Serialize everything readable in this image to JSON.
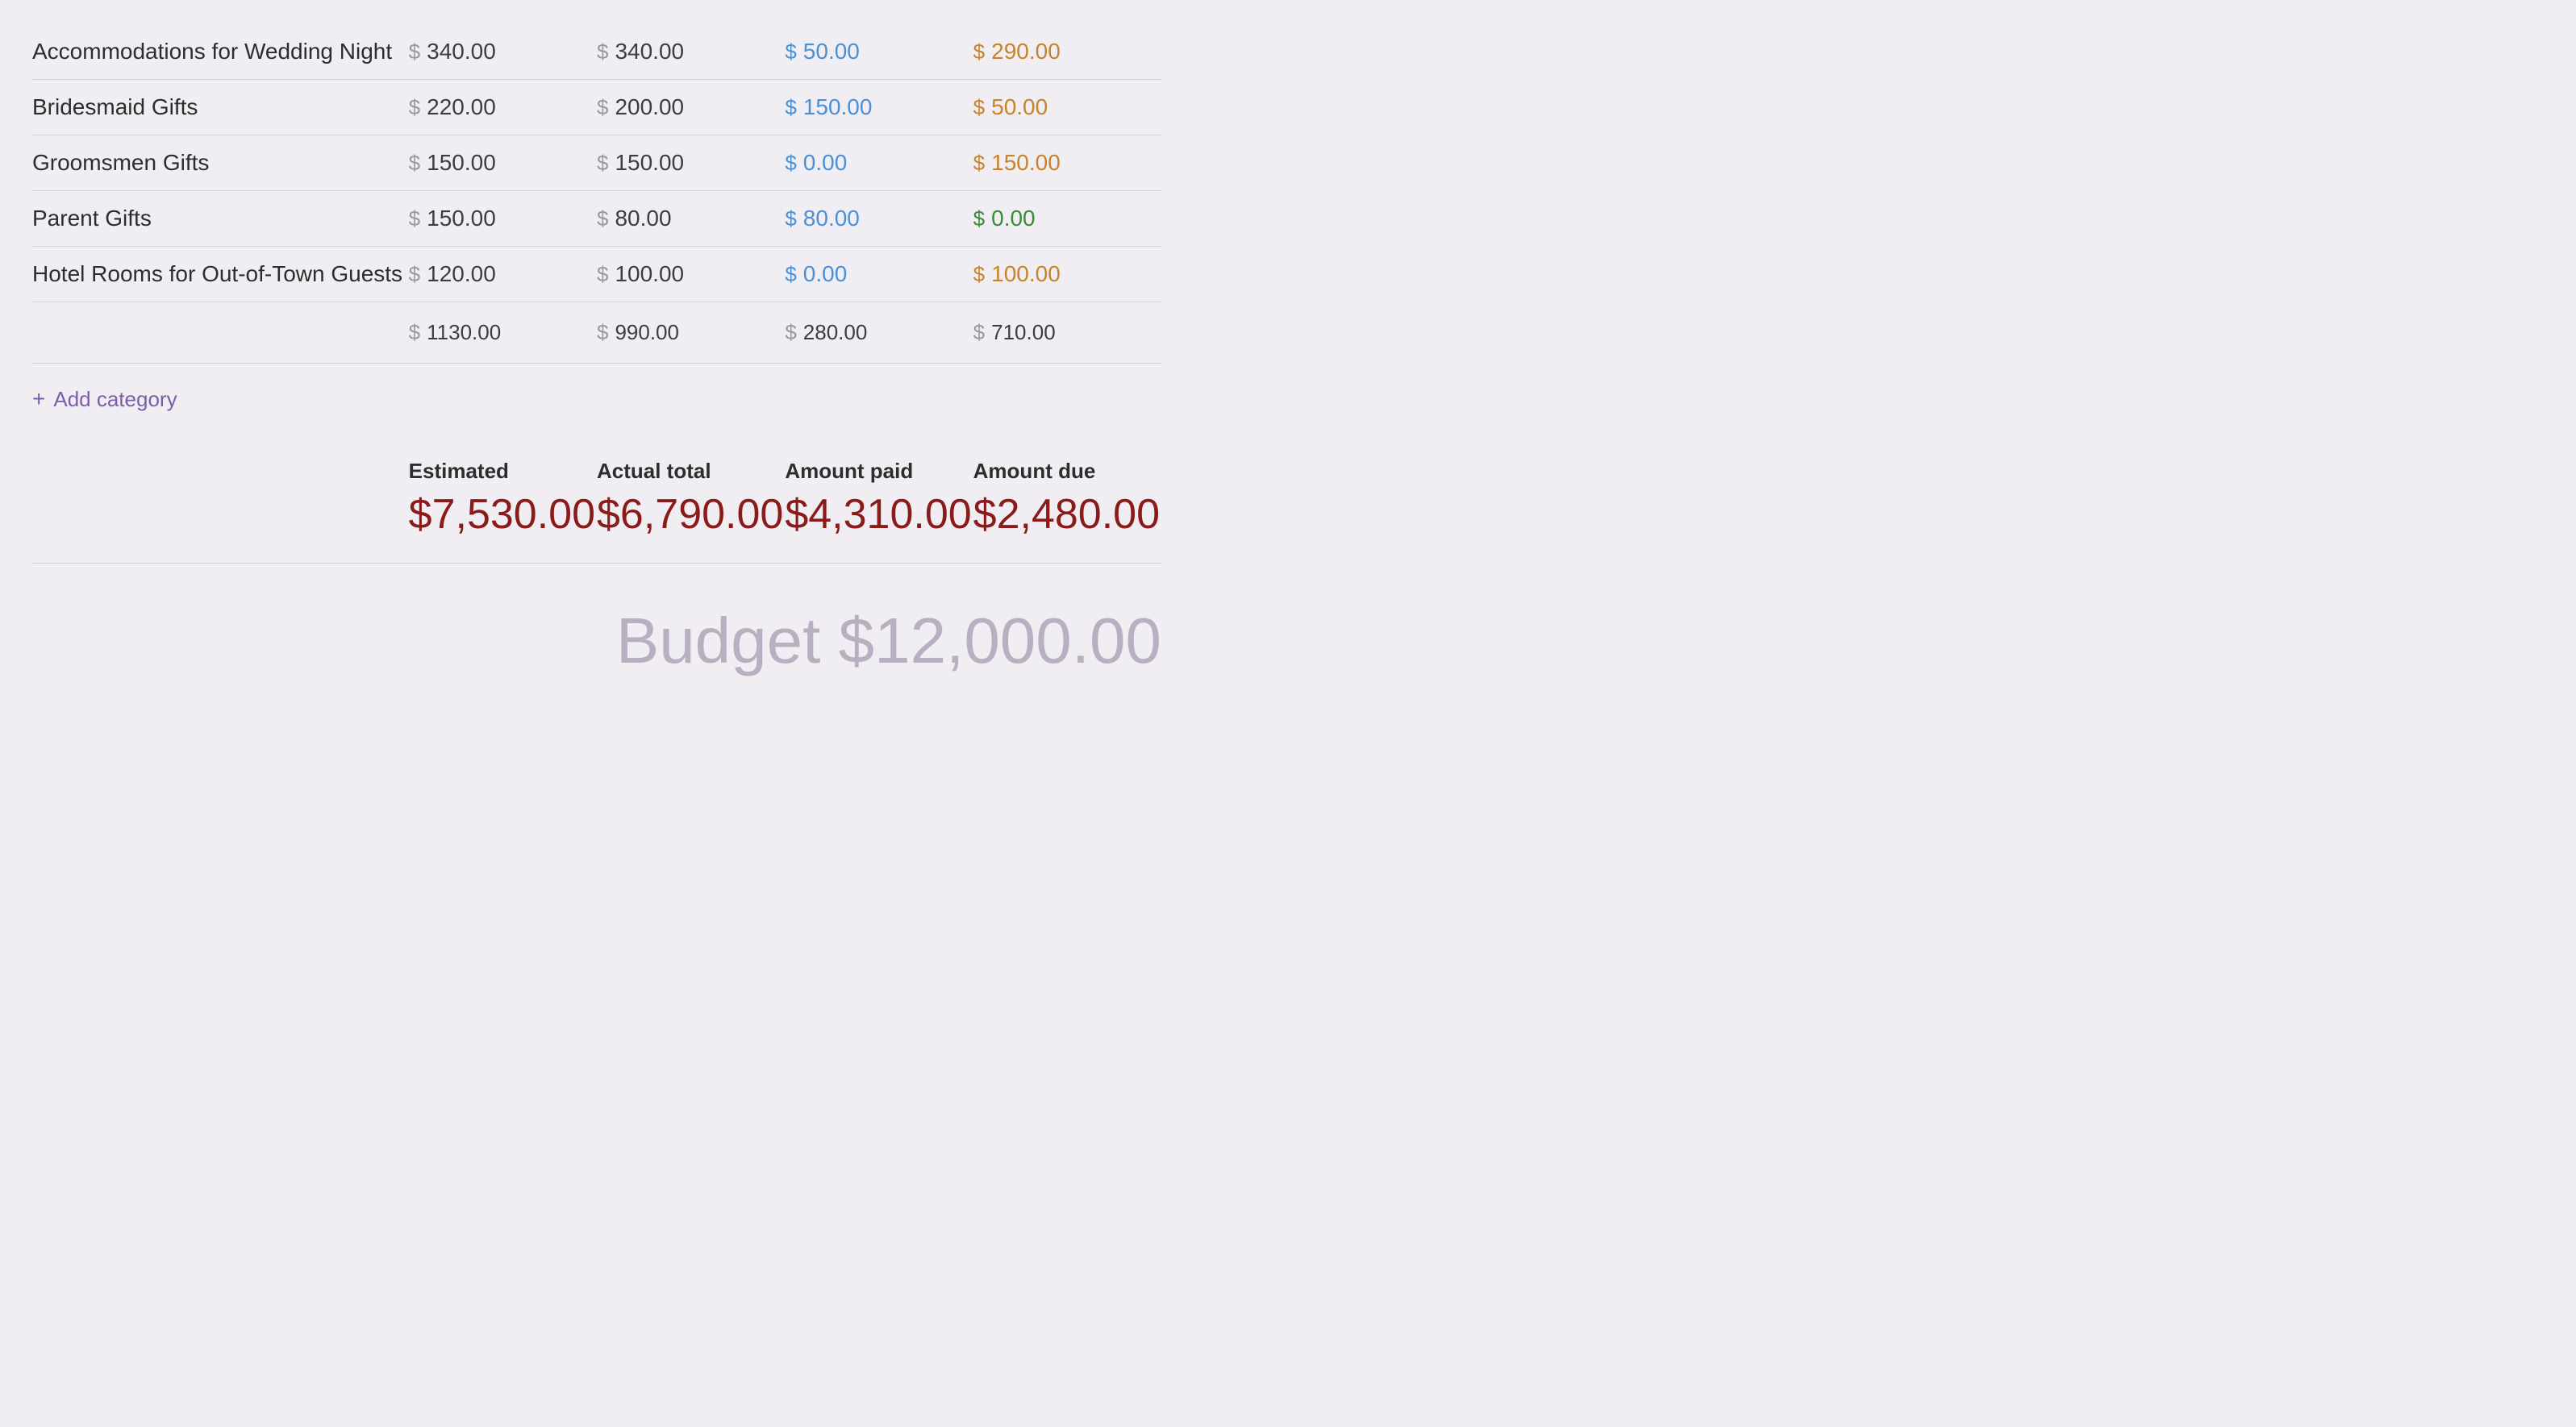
{
  "rows": [
    {
      "name": "Accommodations for Wedding Night",
      "estimated": "340.00",
      "actual": "340.00",
      "paid": "50.00",
      "due": "290.00",
      "due_color": "orange"
    },
    {
      "name": "Bridesmaid Gifts",
      "estimated": "220.00",
      "actual": "200.00",
      "paid": "150.00",
      "due": "50.00",
      "due_color": "orange"
    },
    {
      "name": "Groomsmen Gifts",
      "estimated": "150.00",
      "actual": "150.00",
      "paid": "0.00",
      "due": "150.00",
      "due_color": "orange"
    },
    {
      "name": "Parent Gifts",
      "estimated": "150.00",
      "actual": "80.00",
      "paid": "80.00",
      "due": "0.00",
      "due_color": "green"
    },
    {
      "name": "Hotel Rooms for Out-of-Town Guests",
      "estimated": "120.00",
      "actual": "100.00",
      "paid": "0.00",
      "due": "100.00",
      "due_color": "orange"
    }
  ],
  "totals": {
    "estimated": "1130.00",
    "actual": "990.00",
    "paid": "280.00",
    "due": "710.00"
  },
  "add_category_label": "Add category",
  "summary": {
    "estimated_label": "Estimated",
    "estimated_value": "$7,530.00",
    "actual_label": "Actual total",
    "actual_value": "$6,790.00",
    "paid_label": "Amount paid",
    "paid_value": "$4,310.00",
    "due_label": "Amount due",
    "due_value": "$2,480.00"
  },
  "budget_label": "Budget $12,000.00"
}
